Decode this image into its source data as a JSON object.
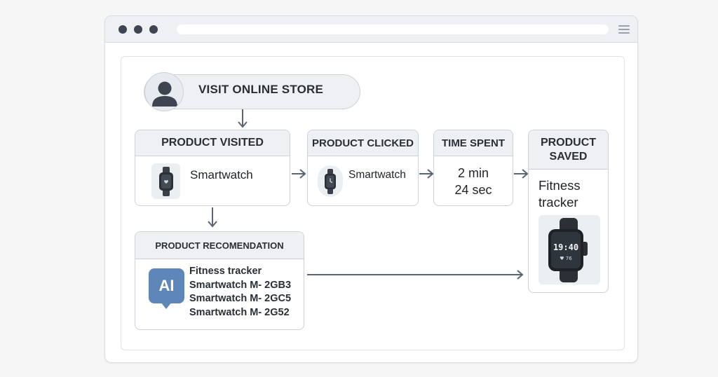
{
  "browser": {
    "title_dots": [
      "close",
      "minimize",
      "maximize"
    ],
    "menu_icon": "hamburger-menu-icon"
  },
  "flow": {
    "start": {
      "label": "VISIT ONLINE STORE",
      "icon": "user-avatar-icon"
    },
    "product_visited": {
      "title": "PRODUCT VISITED",
      "item": "Smartwatch",
      "icon": "smartwatch-icon"
    },
    "product_clicked": {
      "title": "PRODUCT CLICKED",
      "item": "Smartwatch",
      "icon": "smartwatch-icon"
    },
    "time_spent": {
      "title": "TIME SPENT",
      "line1": "2 min",
      "line2": "24 sec"
    },
    "product_saved": {
      "title_line1": "PRODUCT",
      "title_line2": "SAVED",
      "item_line1": "Fitness",
      "item_line2": "tracker",
      "image_time": "19:40",
      "image_heart": "♥ 76"
    },
    "recommendation": {
      "title": "PRODUCT RECOMENDATION",
      "badge": "AI",
      "items": [
        "Fitness tracker",
        "Smartwatch M- 2GB3",
        "Smartwatch M- 2GC5",
        "Smartwatch M- 2G52"
      ]
    }
  },
  "colors": {
    "accent_ai": "#5f86b8",
    "arrow": "#5a6472",
    "border": "#cdd2d8",
    "header_bg": "#eef0f3"
  }
}
